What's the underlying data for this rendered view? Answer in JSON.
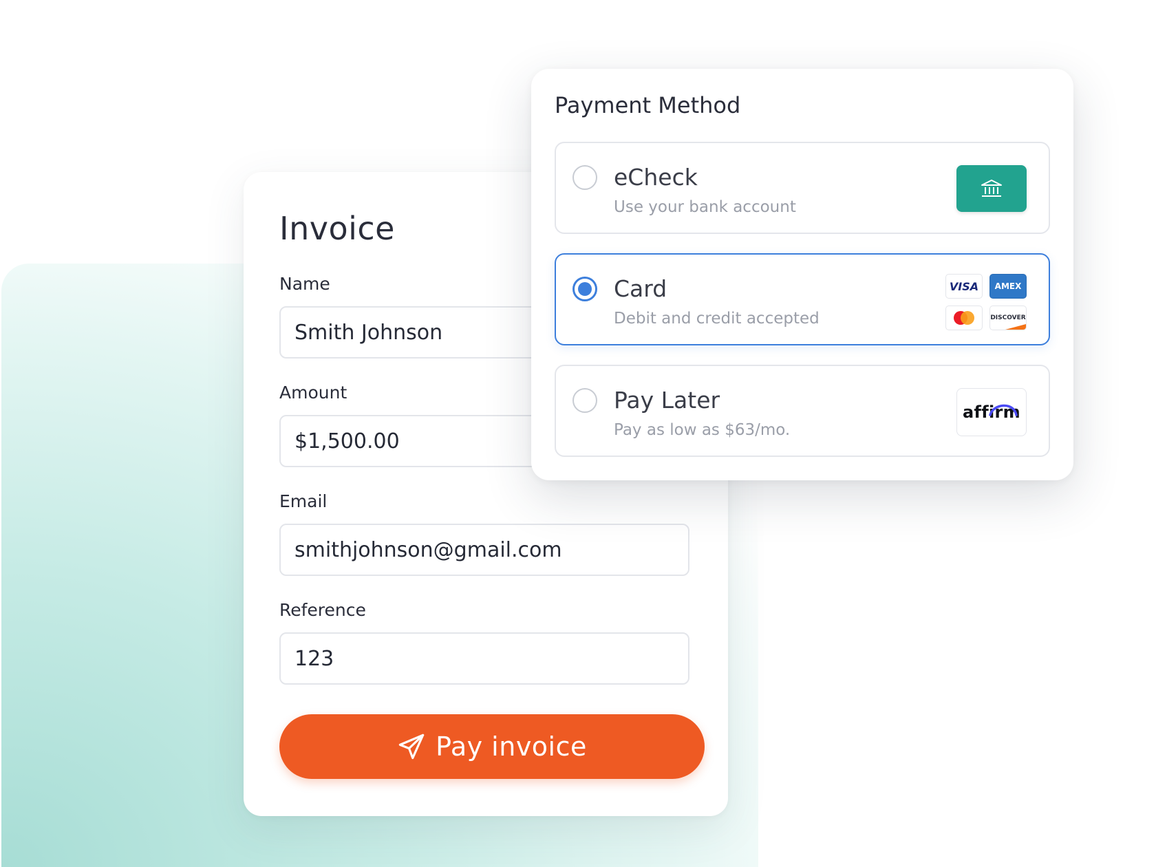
{
  "invoice": {
    "title": "Invoice",
    "fields": {
      "name": {
        "label": "Name",
        "value": "Smith Johnson"
      },
      "amount": {
        "label": "Amount",
        "value": "$1,500.00"
      },
      "email": {
        "label": "Email",
        "value": "smithjohnson@gmail.com"
      },
      "reference": {
        "label": "Reference",
        "value": "123"
      }
    },
    "pay_button_label": "Pay invoice"
  },
  "payment": {
    "title": "Payment Method",
    "options": [
      {
        "title": "eCheck",
        "subtitle": "Use your bank account",
        "selected": false,
        "icon": "bank-icon"
      },
      {
        "title": "Card",
        "subtitle": "Debit and credit accepted",
        "selected": true,
        "brands": [
          "VISA",
          "AMEX",
          "Mastercard",
          "DISCOVER"
        ]
      },
      {
        "title": "Pay Later",
        "subtitle": "Pay as low as $63/mo.",
        "selected": false,
        "logo": "affirm"
      }
    ]
  },
  "colors": {
    "accent_orange": "#ee5a23",
    "selected_blue": "#3d7fdc",
    "bank_green": "#22a38f",
    "background_teal": "#a7ddd5"
  }
}
